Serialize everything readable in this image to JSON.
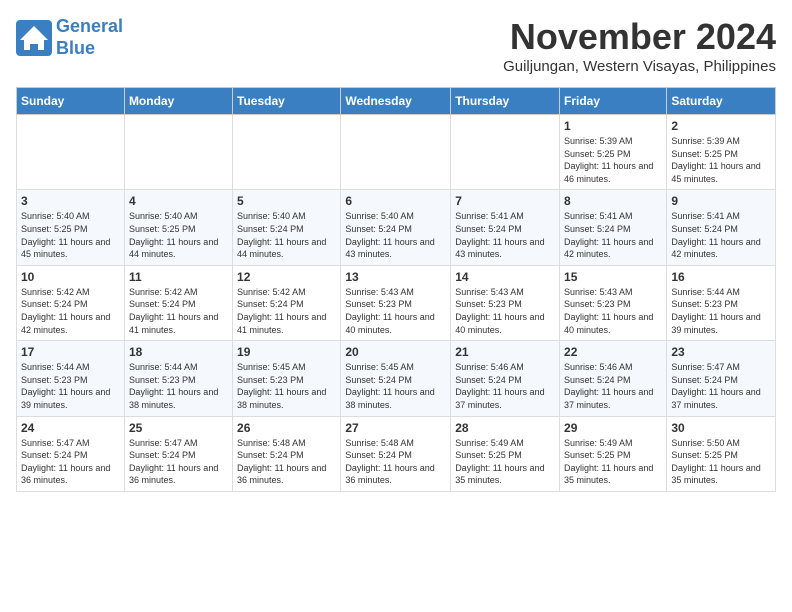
{
  "logo": {
    "line1": "General",
    "line2": "Blue"
  },
  "title": "November 2024",
  "location": "Guiljungan, Western Visayas, Philippines",
  "weekdays": [
    "Sunday",
    "Monday",
    "Tuesday",
    "Wednesday",
    "Thursday",
    "Friday",
    "Saturday"
  ],
  "weeks": [
    [
      {
        "day": "",
        "info": ""
      },
      {
        "day": "",
        "info": ""
      },
      {
        "day": "",
        "info": ""
      },
      {
        "day": "",
        "info": ""
      },
      {
        "day": "",
        "info": ""
      },
      {
        "day": "1",
        "info": "Sunrise: 5:39 AM\nSunset: 5:25 PM\nDaylight: 11 hours and 46 minutes."
      },
      {
        "day": "2",
        "info": "Sunrise: 5:39 AM\nSunset: 5:25 PM\nDaylight: 11 hours and 45 minutes."
      }
    ],
    [
      {
        "day": "3",
        "info": "Sunrise: 5:40 AM\nSunset: 5:25 PM\nDaylight: 11 hours and 45 minutes."
      },
      {
        "day": "4",
        "info": "Sunrise: 5:40 AM\nSunset: 5:25 PM\nDaylight: 11 hours and 44 minutes."
      },
      {
        "day": "5",
        "info": "Sunrise: 5:40 AM\nSunset: 5:24 PM\nDaylight: 11 hours and 44 minutes."
      },
      {
        "day": "6",
        "info": "Sunrise: 5:40 AM\nSunset: 5:24 PM\nDaylight: 11 hours and 43 minutes."
      },
      {
        "day": "7",
        "info": "Sunrise: 5:41 AM\nSunset: 5:24 PM\nDaylight: 11 hours and 43 minutes."
      },
      {
        "day": "8",
        "info": "Sunrise: 5:41 AM\nSunset: 5:24 PM\nDaylight: 11 hours and 42 minutes."
      },
      {
        "day": "9",
        "info": "Sunrise: 5:41 AM\nSunset: 5:24 PM\nDaylight: 11 hours and 42 minutes."
      }
    ],
    [
      {
        "day": "10",
        "info": "Sunrise: 5:42 AM\nSunset: 5:24 PM\nDaylight: 11 hours and 42 minutes."
      },
      {
        "day": "11",
        "info": "Sunrise: 5:42 AM\nSunset: 5:24 PM\nDaylight: 11 hours and 41 minutes."
      },
      {
        "day": "12",
        "info": "Sunrise: 5:42 AM\nSunset: 5:24 PM\nDaylight: 11 hours and 41 minutes."
      },
      {
        "day": "13",
        "info": "Sunrise: 5:43 AM\nSunset: 5:23 PM\nDaylight: 11 hours and 40 minutes."
      },
      {
        "day": "14",
        "info": "Sunrise: 5:43 AM\nSunset: 5:23 PM\nDaylight: 11 hours and 40 minutes."
      },
      {
        "day": "15",
        "info": "Sunrise: 5:43 AM\nSunset: 5:23 PM\nDaylight: 11 hours and 40 minutes."
      },
      {
        "day": "16",
        "info": "Sunrise: 5:44 AM\nSunset: 5:23 PM\nDaylight: 11 hours and 39 minutes."
      }
    ],
    [
      {
        "day": "17",
        "info": "Sunrise: 5:44 AM\nSunset: 5:23 PM\nDaylight: 11 hours and 39 minutes."
      },
      {
        "day": "18",
        "info": "Sunrise: 5:44 AM\nSunset: 5:23 PM\nDaylight: 11 hours and 38 minutes."
      },
      {
        "day": "19",
        "info": "Sunrise: 5:45 AM\nSunset: 5:23 PM\nDaylight: 11 hours and 38 minutes."
      },
      {
        "day": "20",
        "info": "Sunrise: 5:45 AM\nSunset: 5:24 PM\nDaylight: 11 hours and 38 minutes."
      },
      {
        "day": "21",
        "info": "Sunrise: 5:46 AM\nSunset: 5:24 PM\nDaylight: 11 hours and 37 minutes."
      },
      {
        "day": "22",
        "info": "Sunrise: 5:46 AM\nSunset: 5:24 PM\nDaylight: 11 hours and 37 minutes."
      },
      {
        "day": "23",
        "info": "Sunrise: 5:47 AM\nSunset: 5:24 PM\nDaylight: 11 hours and 37 minutes."
      }
    ],
    [
      {
        "day": "24",
        "info": "Sunrise: 5:47 AM\nSunset: 5:24 PM\nDaylight: 11 hours and 36 minutes."
      },
      {
        "day": "25",
        "info": "Sunrise: 5:47 AM\nSunset: 5:24 PM\nDaylight: 11 hours and 36 minutes."
      },
      {
        "day": "26",
        "info": "Sunrise: 5:48 AM\nSunset: 5:24 PM\nDaylight: 11 hours and 36 minutes."
      },
      {
        "day": "27",
        "info": "Sunrise: 5:48 AM\nSunset: 5:24 PM\nDaylight: 11 hours and 36 minutes."
      },
      {
        "day": "28",
        "info": "Sunrise: 5:49 AM\nSunset: 5:25 PM\nDaylight: 11 hours and 35 minutes."
      },
      {
        "day": "29",
        "info": "Sunrise: 5:49 AM\nSunset: 5:25 PM\nDaylight: 11 hours and 35 minutes."
      },
      {
        "day": "30",
        "info": "Sunrise: 5:50 AM\nSunset: 5:25 PM\nDaylight: 11 hours and 35 minutes."
      }
    ]
  ]
}
